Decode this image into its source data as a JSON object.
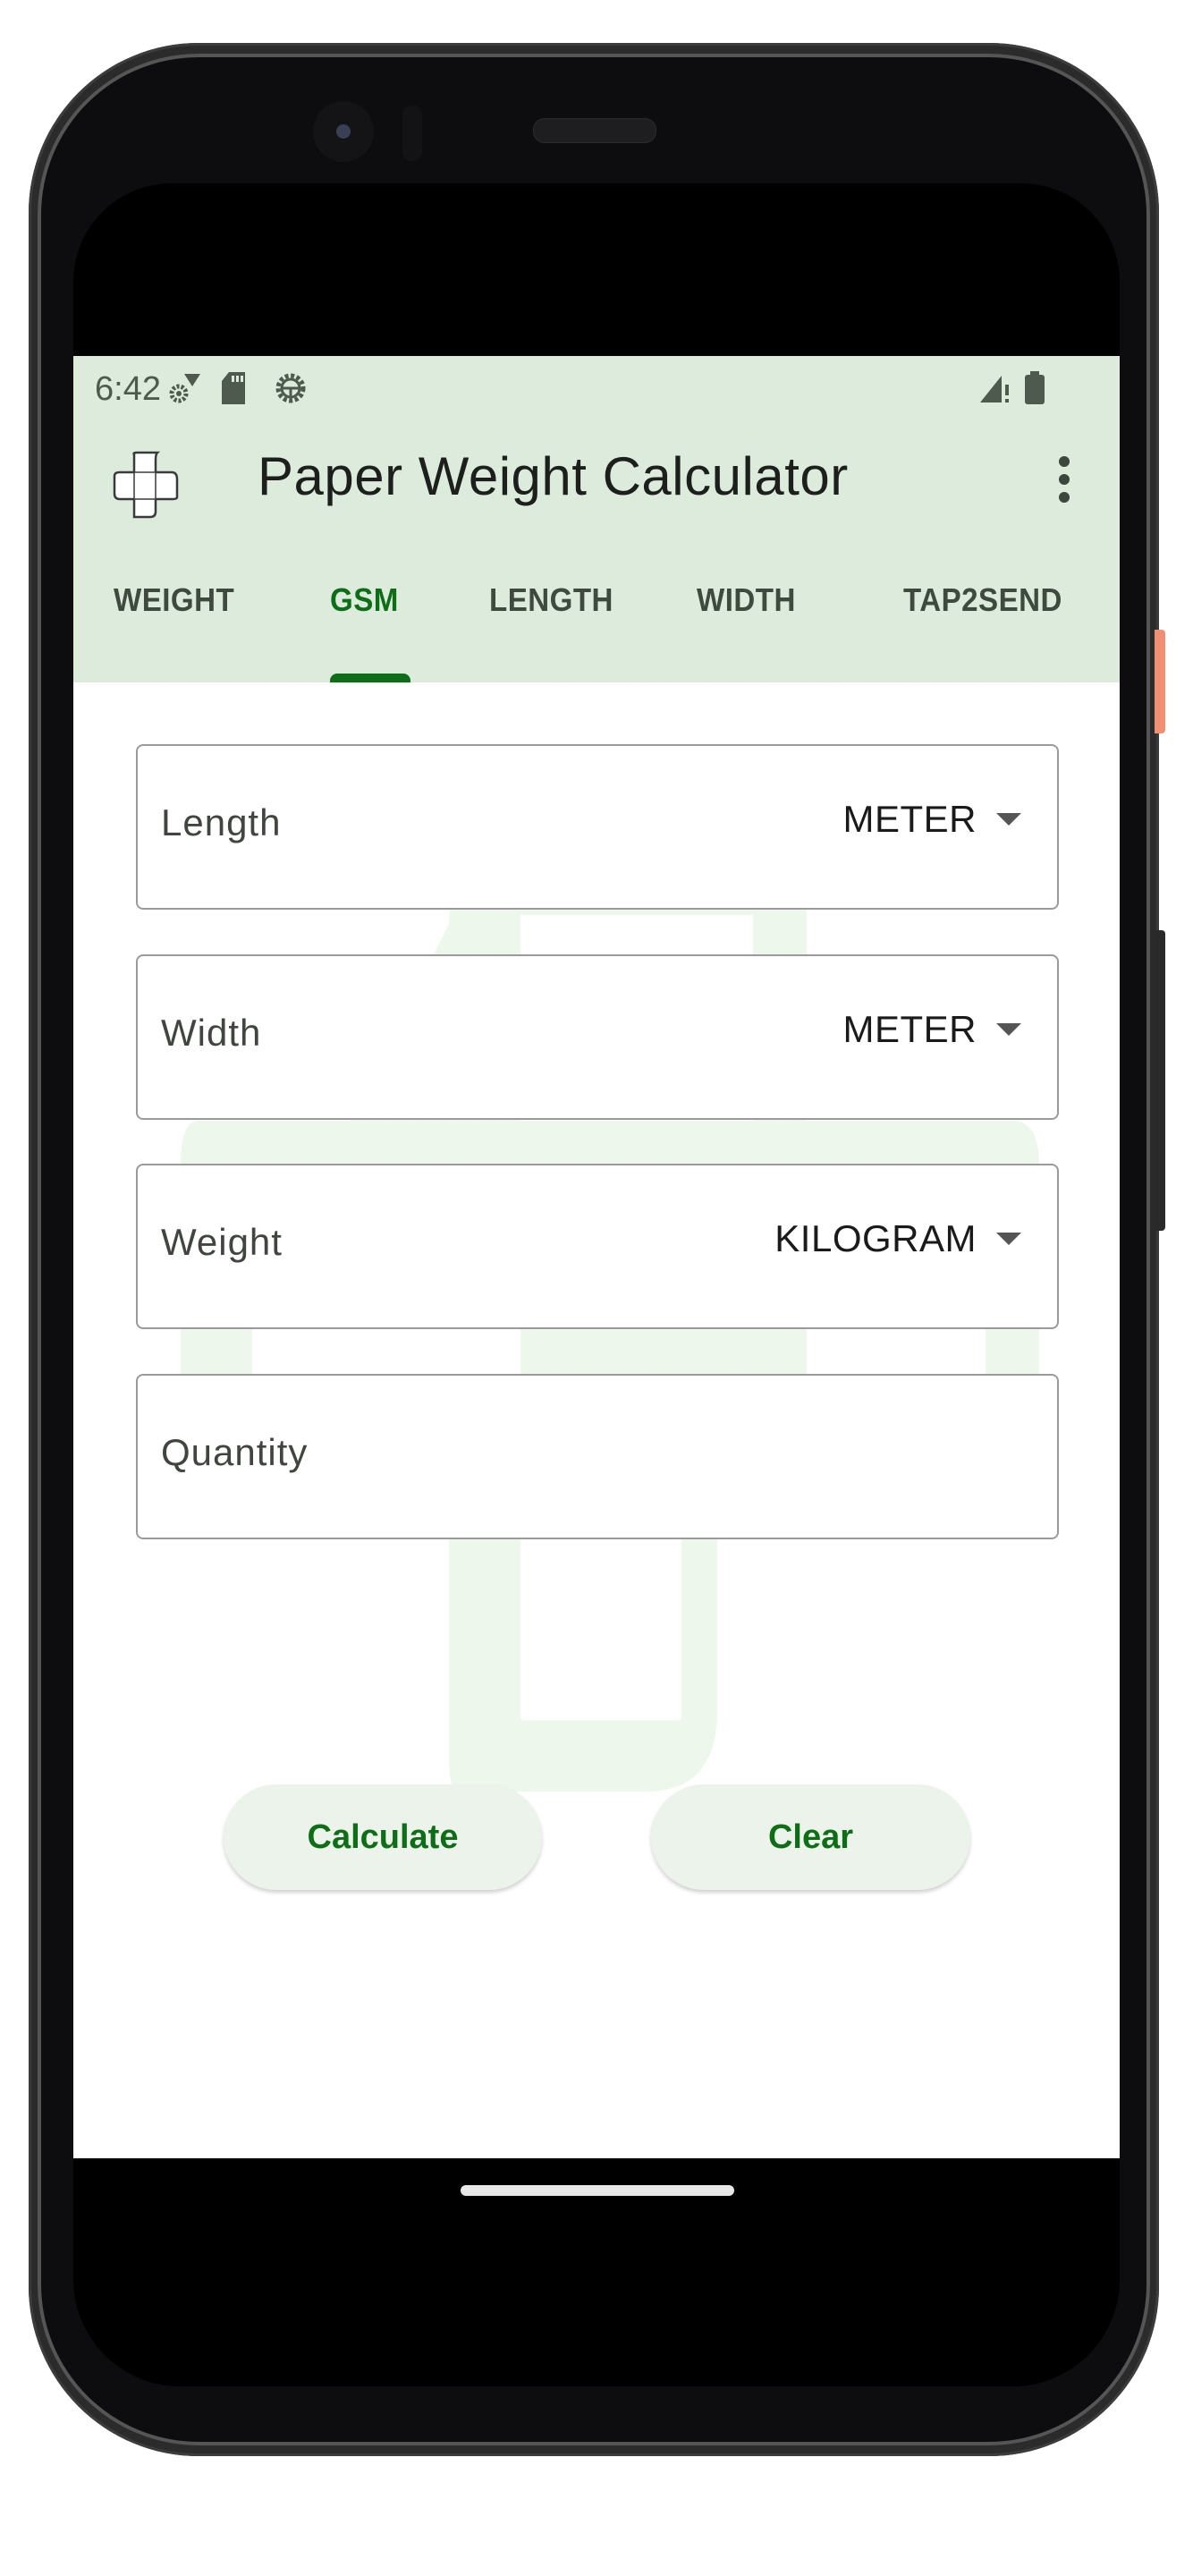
{
  "status_bar": {
    "time": "6:42",
    "left_icons": [
      "settings-wifi-icon",
      "sd-card-icon",
      "debug-gear-icon"
    ],
    "right_icons": [
      "signal-no-data-icon",
      "battery-icon"
    ]
  },
  "app_bar": {
    "logo": "app-logo-cross-icon",
    "title": "Paper Weight Calculator",
    "overflow_icon": "more-vert-icon"
  },
  "tabs": [
    {
      "label": "WEIGHT",
      "active": false
    },
    {
      "label": "GSM",
      "active": true
    },
    {
      "label": "LENGTH",
      "active": false
    },
    {
      "label": "WIDTH",
      "active": false
    },
    {
      "label": "TAP2SEND",
      "active": false
    }
  ],
  "form": {
    "fields": [
      {
        "label": "Length",
        "value": "",
        "unit": "METER",
        "has_unit": true
      },
      {
        "label": "Width",
        "value": "",
        "unit": "METER",
        "has_unit": true
      },
      {
        "label": "Weight",
        "value": "",
        "unit": "KILOGRAM",
        "has_unit": true
      },
      {
        "label": "Quantity",
        "value": "",
        "has_unit": false
      }
    ]
  },
  "actions": {
    "calculate_label": "Calculate",
    "clear_label": "Clear"
  },
  "colors": {
    "accent": "#0e6d17",
    "app_bar_bg": "#dcebdc",
    "button_bg": "#ecf3ea",
    "field_border": "#9a9a9a"
  }
}
